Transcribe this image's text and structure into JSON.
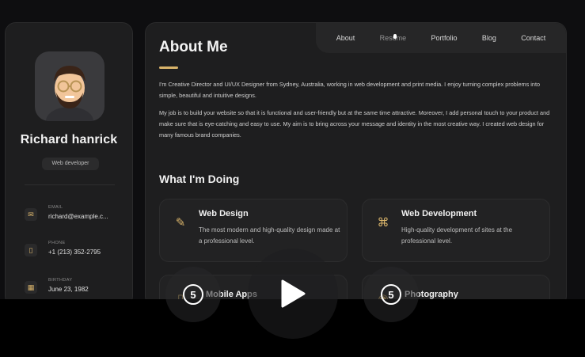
{
  "sidebar": {
    "name": "Richard hanrick",
    "role": "Web developer",
    "contacts": [
      {
        "label": "Email",
        "value": "richard@example.c...",
        "icon": "mail-icon"
      },
      {
        "label": "Phone",
        "value": "+1 (213) 352-2795",
        "icon": "phone-icon"
      },
      {
        "label": "Birthday",
        "value": "June 23, 1982",
        "icon": "calendar-icon"
      }
    ]
  },
  "nav": {
    "items": [
      "About",
      "Resume",
      "Portfolio",
      "Blog",
      "Contact"
    ]
  },
  "about": {
    "title": "About Me",
    "para1": "I'm Creative Director and UI/UX Designer from Sydney, Australia, working in web development and print media. I enjoy turning complex problems into simple, beautiful and intuitive designs.",
    "para2": "My job is to build your website so that it is functional and user-friendly but at the same time attractive. Moreover, I add personal touch to your product and make sure that is eye-catching and easy to use. My aim is to bring across your message and identity in the most creative way. I created web design for many famous brand companies."
  },
  "doing": {
    "title": "What I'm Doing",
    "cards": [
      {
        "title": "Web Design",
        "desc": "The most modern and high-quality design made at a professional level.",
        "icon": "design-icon"
      },
      {
        "title": "Web Development",
        "desc": "High-quality development of sites at the professional level.",
        "icon": "code-icon"
      },
      {
        "title": "Mobile Apps",
        "desc": "",
        "icon": "mobile-icon"
      },
      {
        "title": "Photography",
        "desc": "",
        "icon": "camera-icon"
      }
    ]
  },
  "player": {
    "rewind_seconds": "5",
    "forward_seconds": "5"
  },
  "colors": {
    "accent": "#d8b36a",
    "panel": "#1e1e1f",
    "background": "#0e0e10"
  }
}
